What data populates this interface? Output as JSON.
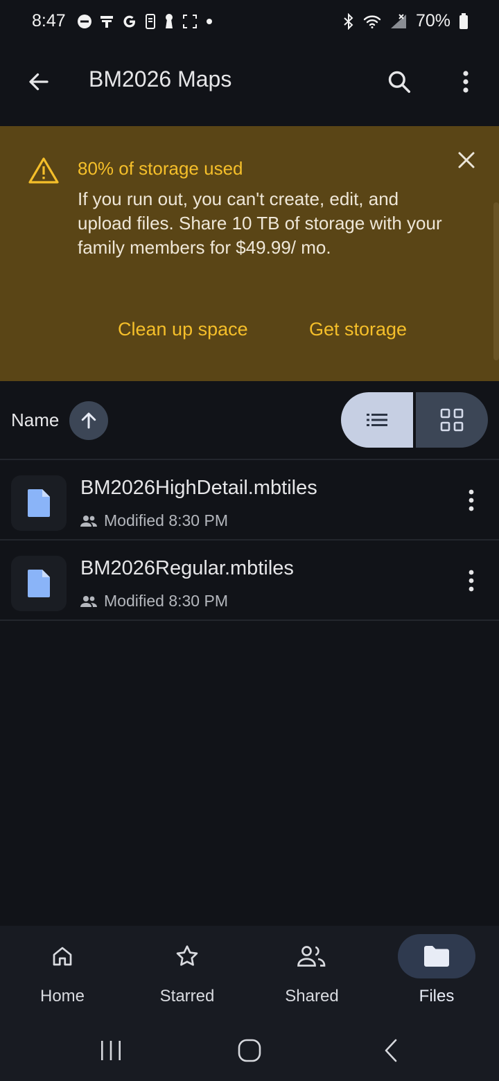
{
  "status_bar": {
    "time": "8:47",
    "battery": "70%",
    "left_icons": [
      "do-not-disturb-icon",
      "notification-icon",
      "google-icon",
      "phone-icon",
      "keyhole-icon",
      "screenshot-frame-icon",
      "dot-icon"
    ],
    "right_icons": [
      "bluetooth-icon",
      "wifi-icon",
      "no-signal-icon",
      "battery-icon"
    ]
  },
  "app_bar": {
    "title": "BM2026 Maps",
    "back_icon": "arrow-back-icon",
    "search_icon": "search-icon",
    "more_icon": "more-vert-icon"
  },
  "banner": {
    "title": "80% of storage used",
    "body": "If you run out, you can't create, edit, and upload files. Share 10 TB of storage with your family members for $49.99/ mo.",
    "clean_up_label": "Clean up space",
    "get_storage_label": "Get storage",
    "colors": {
      "background": "#5a4516",
      "accent": "#f5bf2a"
    }
  },
  "sort": {
    "label": "Name",
    "direction": "ascending",
    "view_mode": "list"
  },
  "files": [
    {
      "name": "BM2026HighDetail.mbtiles",
      "meta": "Modified 8:30 PM",
      "shared": true
    },
    {
      "name": "BM2026Regular.mbtiles",
      "meta": "Modified 8:30 PM",
      "shared": true
    }
  ],
  "bottom_nav": {
    "items": [
      {
        "label": "Home",
        "icon": "home-icon",
        "active": false
      },
      {
        "label": "Starred",
        "icon": "star-icon",
        "active": false
      },
      {
        "label": "Shared",
        "icon": "people-icon",
        "active": false
      },
      {
        "label": "Files",
        "icon": "folder-icon",
        "active": true
      }
    ]
  },
  "system_nav": [
    "recents-icon",
    "home-circle-icon",
    "back-chevron-icon"
  ]
}
